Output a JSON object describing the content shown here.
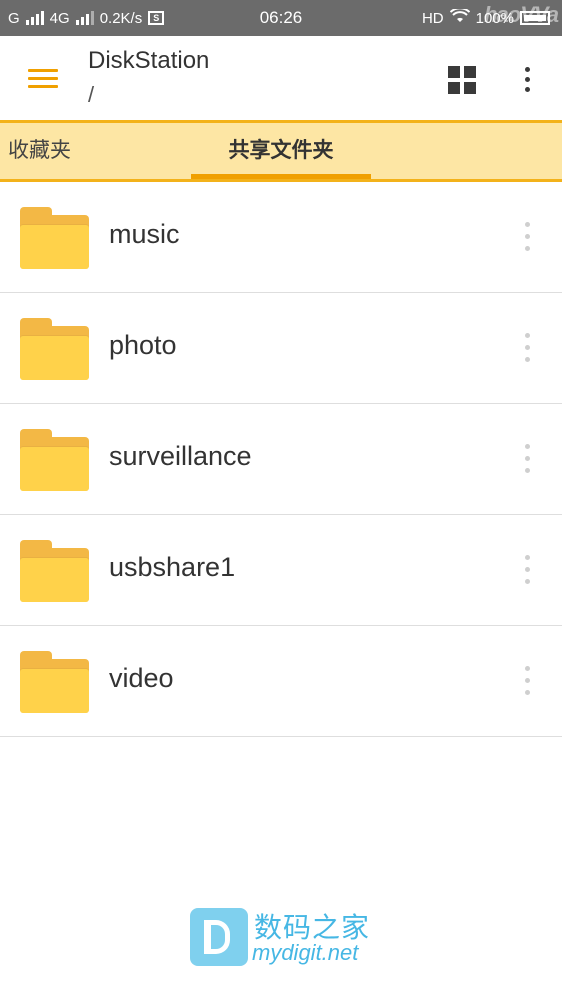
{
  "status_bar": {
    "carrier1": "G",
    "carrier2": "4G",
    "net_speed": "0.2K/s",
    "time": "06:26",
    "hd": "HD",
    "battery": "100%",
    "watermark": "haoVVa"
  },
  "app_bar": {
    "title": "DiskStation",
    "path": "/"
  },
  "tabs": [
    {
      "label": "收藏夹",
      "active": false
    },
    {
      "label": "共享文件夹",
      "active": true
    }
  ],
  "folders": [
    {
      "name": "music"
    },
    {
      "name": "photo"
    },
    {
      "name": "surveillance"
    },
    {
      "name": "usbshare1"
    },
    {
      "name": "video"
    }
  ],
  "footer_watermark": {
    "cn": "数码之家",
    "url": "mydigit.net"
  },
  "colors": {
    "accent": "#f0a000",
    "tab_background": "#fde6a4",
    "folder": "#ffd24a",
    "status_bar": "#6b6b6b"
  }
}
